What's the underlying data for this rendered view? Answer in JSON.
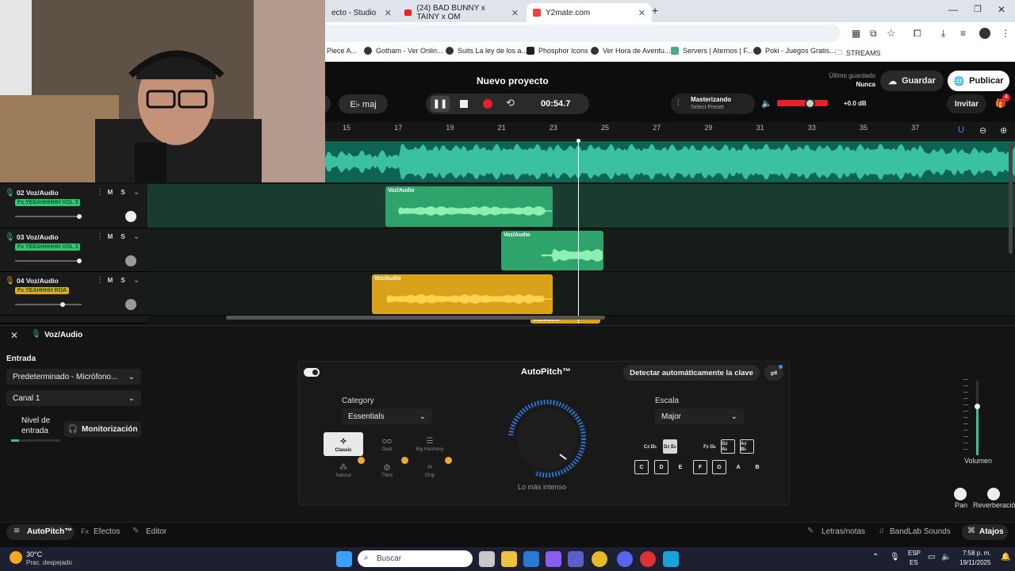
{
  "browser": {
    "tabs": [
      {
        "label": "ecto - Studio"
      },
      {
        "label": "(24) BAD BUNNY x TAINY x OM"
      },
      {
        "label": "Y2mate.com"
      }
    ],
    "bookmarks": [
      "Piece A...",
      "Gotham - Ver Onlin...",
      "Suits La ley de los a...",
      "Phosphor Icons",
      "Ver Hora de Aventu...",
      "Servers | Aternos | F...",
      "Poki - Juegos Gratis...",
      "STREAMS"
    ]
  },
  "header": {
    "project_title": "Nuevo proyecto",
    "last_saved_label": "Último guardado",
    "last_saved_value": "Nunca",
    "save_label": "Guardar",
    "publish_label": "Publicar",
    "key_label": "E♭ maj",
    "time": "00:54.7",
    "mastering_label": "Masterizando",
    "mastering_preset": "Select Preset",
    "gain": "+0.0 dB",
    "invite_label": "Invitar",
    "notif_count": "4"
  },
  "ruler_ticks": [
    "15",
    "17",
    "19",
    "21",
    "23",
    "25",
    "27",
    "29",
    "31",
    "33",
    "35",
    "37"
  ],
  "tracks": [
    {
      "name": "02  Voz/Audio",
      "fx": "Fx YEEAHHHHH VOL 3",
      "fx_color": "#36c27a",
      "M": "M",
      "S": "S"
    },
    {
      "name": "03  Voz/Audio",
      "fx": "Fx YEEAHHHHH VOL 3",
      "fx_color": "#36c27a",
      "M": "M",
      "S": "S"
    },
    {
      "name": "04  Voz/Audio",
      "fx": "Fx YEAHHHH ROA",
      "fx_color": "#e6a51a",
      "M": "M",
      "S": "S"
    }
  ],
  "clips": [
    {
      "label": "Voz/Audio"
    },
    {
      "label": "Voz/Audio"
    },
    {
      "label": "Voz/Audio"
    },
    {
      "label": "Voz/Audio"
    }
  ],
  "panel": {
    "title": "Voz/Audio",
    "input_label": "Entrada",
    "input_device": "Predeterminado - Micrófono...",
    "channel": "Canal 1",
    "level_label_1": "Nivel de",
    "level_label_2": "entrada",
    "monitor_label": "Monitorización"
  },
  "autopitch": {
    "title": "AutoPitch™",
    "detect_label": "Detectar automáticamente la clave",
    "category_label": "Category",
    "category_value": "Essentials",
    "categories": [
      "Classic",
      "Duet",
      "Big Harmony",
      "Natural",
      "Third",
      "Chip"
    ],
    "knob_label": "Lo más intenso",
    "scale_label": "Escala",
    "scale_value": "Major",
    "black_keys": [
      "C♯ D♭",
      "D♯ E♭",
      "F♯ G♭",
      "G♯ A♭",
      "A♯ B♭"
    ],
    "white_keys": [
      "C",
      "D",
      "E",
      "F",
      "G",
      "A",
      "B"
    ],
    "volume_label": "Volumen",
    "pan_label": "Pan",
    "reverb_label": "Reverberación"
  },
  "footer": {
    "tab_autopitch": "AutoPitch™",
    "tab_effects": "Efectos",
    "tab_editor": "Editor",
    "lyrics": "Letras/notas",
    "sounds": "BandLab Sounds",
    "shortcuts": "Atajos"
  },
  "taskbar": {
    "temp": "30°C",
    "weather": "Prac. despejado",
    "search": "Buscar",
    "lang1": "ESP",
    "lang2": "ES",
    "time": "7:58 p. m.",
    "date": "19/11/2025"
  },
  "colors": {
    "accent": "#3ac18a",
    "orange": "#e6a51a",
    "record": "#e5212b"
  }
}
